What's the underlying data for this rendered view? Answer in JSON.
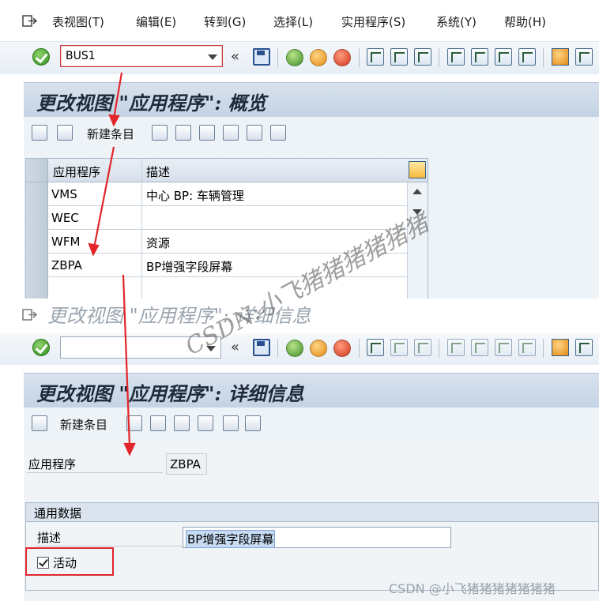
{
  "menu": {
    "items": [
      "表视图(T)",
      "编辑(E)",
      "转到(G)",
      "选择(L)",
      "实用程序(S)",
      "系统(Y)",
      "帮助(H)"
    ]
  },
  "toolbar_top": {
    "command_value": "BUS1",
    "back_symbol": "«"
  },
  "toolbar_lower": {
    "command_value": "",
    "back_symbol": "«"
  },
  "overview": {
    "title": "更改视图 \"应用程序\": 概览",
    "new_entries_label": "新建条目",
    "table": {
      "headers": [
        "应用程序",
        "描述"
      ],
      "rows": [
        {
          "app": "VMS",
          "desc": "中心 BP: 车辆管理"
        },
        {
          "app": "WEC",
          "desc": ""
        },
        {
          "app": "WFM",
          "desc": "资源"
        },
        {
          "app": "ZBPA",
          "desc": "BP增强字段屏幕"
        }
      ]
    }
  },
  "ghost_title": "更改视图 \"应用程序\": 详细信息",
  "detail": {
    "title": "更改视图 \"应用程序\": 详细信息",
    "new_entries_label": "新建条目",
    "app_label": "应用程序",
    "app_value": "ZBPA",
    "group_title": "通用数据",
    "desc_label": "描述",
    "desc_value": "BP增强字段屏幕",
    "active_label": "活动",
    "active_checked": true
  },
  "watermarks": {
    "diagonal": "CSDN:小飞猪猪猪猪猪猪",
    "bottom_right": "CSDN @小飞猪猪猪猪猪猪猪"
  },
  "colors": {
    "annotation_red": "#e2252a",
    "title_bar": "#c4d3e4"
  }
}
